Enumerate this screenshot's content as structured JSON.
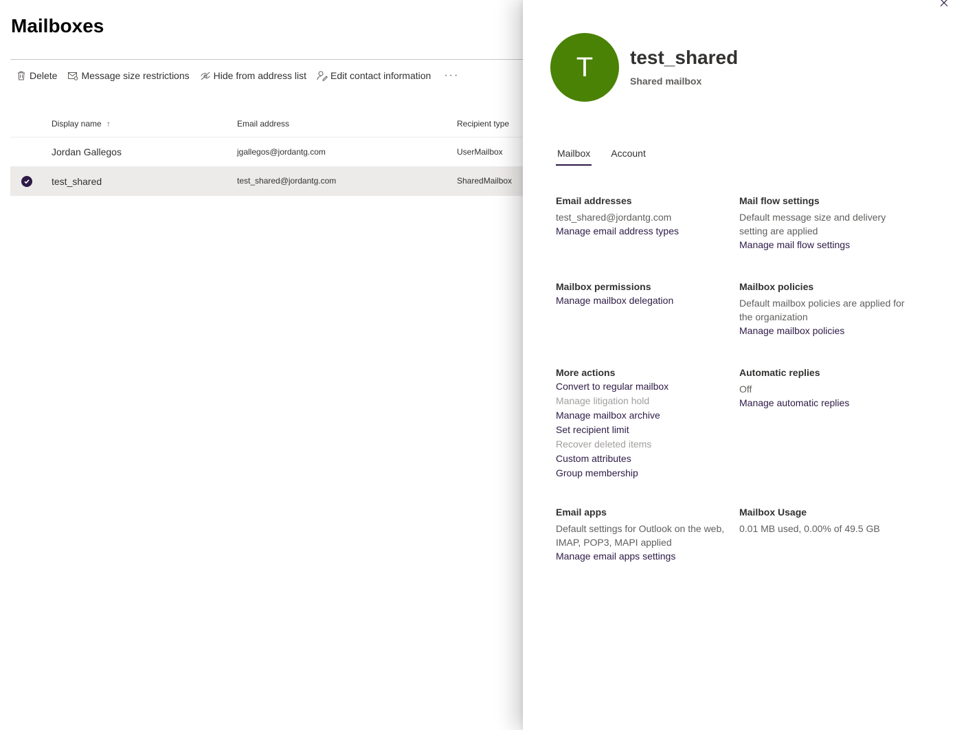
{
  "page": {
    "title": "Mailboxes",
    "toolbar": [
      {
        "label": "Delete",
        "icon": "trash-icon"
      },
      {
        "label": "Message size restrictions",
        "icon": "mail-settings-icon"
      },
      {
        "label": "Hide from address list",
        "icon": "hide-icon"
      },
      {
        "label": "Edit contact information",
        "icon": "edit-contact-icon"
      }
    ],
    "more": "···",
    "columns": {
      "display_name": "Display name",
      "sort_arrow": "↑",
      "email": "Email address",
      "type": "Recipient type"
    },
    "rows": [
      {
        "name": "Jordan Gallegos",
        "email": "jgallegos@jordantg.com",
        "type": "UserMailbox",
        "selected": false
      },
      {
        "name": "test_shared",
        "email": "test_shared@jordantg.com",
        "type": "SharedMailbox",
        "selected": true
      }
    ]
  },
  "panel": {
    "avatar_letter": "T",
    "avatar_color": "#498205",
    "name": "test_shared",
    "subtitle": "Shared mailbox",
    "tabs": [
      {
        "label": "Mailbox",
        "active": true
      },
      {
        "label": "Account",
        "active": false
      }
    ],
    "email_addresses": {
      "heading": "Email addresses",
      "value": "test_shared@jordantg.com",
      "link": "Manage email address types"
    },
    "mail_flow": {
      "heading": "Mail flow settings",
      "text": "Default message size and delivery setting are applied",
      "link": "Manage mail flow settings"
    },
    "permissions": {
      "heading": "Mailbox permissions",
      "link": "Manage mailbox delegation"
    },
    "policies": {
      "heading": "Mailbox policies",
      "text": "Default mailbox policies are applied for the organization",
      "link": "Manage mailbox policies"
    },
    "more_actions": {
      "heading": "More actions",
      "items": [
        {
          "label": "Convert to regular mailbox",
          "enabled": true
        },
        {
          "label": "Manage litigation hold",
          "enabled": false
        },
        {
          "label": "Manage mailbox archive",
          "enabled": true
        },
        {
          "label": "Set recipient limit",
          "enabled": true
        },
        {
          "label": "Recover deleted items",
          "enabled": false
        },
        {
          "label": "Custom attributes",
          "enabled": true
        },
        {
          "label": "Group membership",
          "enabled": true
        }
      ]
    },
    "auto_replies": {
      "heading": "Automatic replies",
      "value": "Off",
      "link": "Manage automatic replies"
    },
    "email_apps": {
      "heading": "Email apps",
      "text": "Default settings for Outlook on the web, IMAP, POP3, MAPI applied",
      "link": "Manage email apps settings"
    },
    "usage": {
      "heading": "Mailbox Usage",
      "text": "0.01 MB used, 0.00% of 49.5 GB"
    }
  },
  "colors": {
    "accent": "#2d1a45",
    "selected_row": "#edebe9"
  }
}
